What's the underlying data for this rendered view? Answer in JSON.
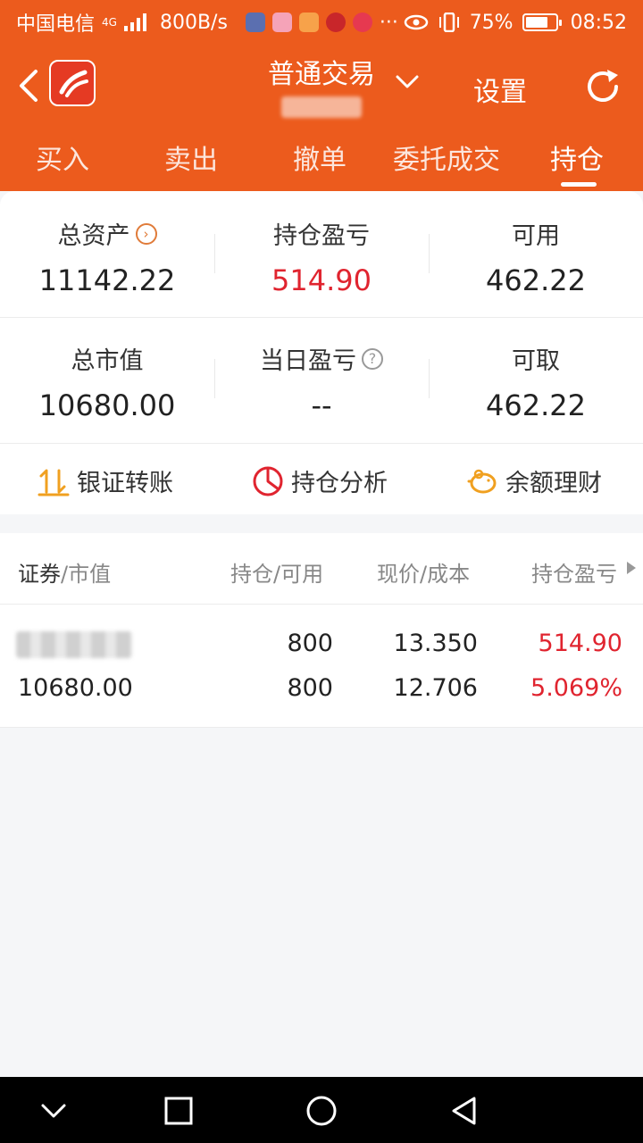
{
  "status_bar": {
    "carrier": "中国电信",
    "network": "4G",
    "speed": "800B/s",
    "more": "···",
    "battery_percent": "75%",
    "battery_level": 0.75,
    "time": "08:52",
    "app_icons": [
      "shield-app-icon",
      "music-app-icon",
      "orange-app-icon",
      "bank-app-icon",
      "flower-app-icon"
    ]
  },
  "header": {
    "title": "普通交易",
    "settings_label": "设置"
  },
  "tabs": [
    {
      "label": "买入"
    },
    {
      "label": "卖出"
    },
    {
      "label": "撤单"
    },
    {
      "label": "委托成交"
    },
    {
      "label": "持仓"
    }
  ],
  "summary": {
    "total_assets": {
      "label": "总资产",
      "value": "11142.22"
    },
    "position_pl": {
      "label": "持仓盈亏",
      "value": "514.90"
    },
    "available": {
      "label": "可用",
      "value": "462.22"
    },
    "total_market_value": {
      "label": "总市值",
      "value": "10680.00"
    },
    "daily_pl": {
      "label": "当日盈亏",
      "value": "--"
    },
    "withdrawable": {
      "label": "可取",
      "value": "462.22"
    }
  },
  "actions": {
    "bank_transfer": "银证转账",
    "position_analysis": "持仓分析",
    "wealth_management": "余额理财"
  },
  "holdings": {
    "headers": {
      "security": "证券",
      "market_value": "/市值",
      "position_available": "持仓/可用",
      "price_cost": "现价/成本",
      "position_pl": "持仓盈亏"
    },
    "rows": [
      {
        "market_value": "10680.00",
        "position": "800",
        "available": "800",
        "price": "13.350",
        "cost": "12.706",
        "pl": "514.90",
        "pl_percent": "5.069%"
      }
    ]
  },
  "colors": {
    "brand": "#ec5b1d",
    "profit_red": "#e0242f"
  }
}
